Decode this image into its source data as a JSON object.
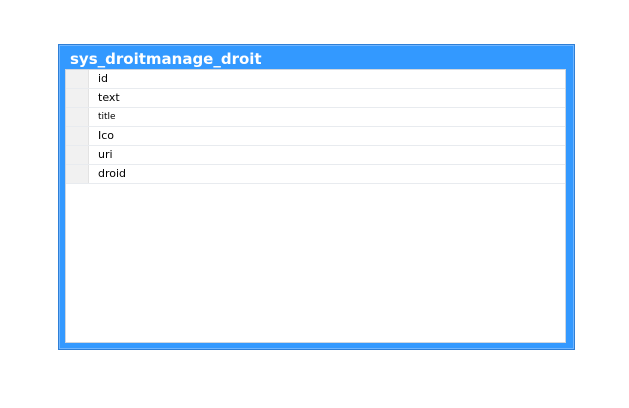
{
  "table": {
    "title": "sys_droitmanage_droit",
    "fields": [
      {
        "name": "id"
      },
      {
        "name": "text"
      },
      {
        "name": "title"
      },
      {
        "name": "Ico"
      },
      {
        "name": "uri"
      },
      {
        "name": "droid"
      }
    ]
  },
  "colors": {
    "window_border": "#3399ff",
    "title_text": "#ffffff",
    "panel_background": "#ffffff"
  }
}
